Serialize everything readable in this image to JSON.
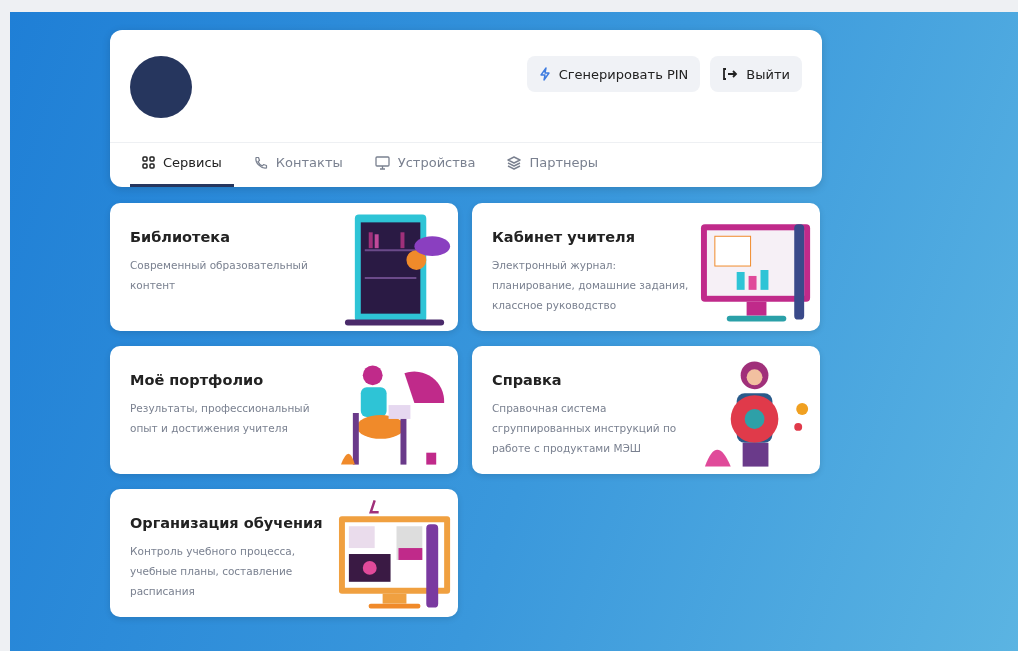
{
  "header": {
    "buttons": [
      {
        "kind": "pin",
        "label": "Сгенерировать PIN"
      },
      {
        "kind": "logout",
        "label": "Выйти"
      }
    ]
  },
  "tabs": [
    {
      "kind": "grid",
      "label": "Сервисы",
      "selected": true
    },
    {
      "kind": "phone",
      "label": "Контакты",
      "selected": false
    },
    {
      "kind": "monitor",
      "label": "Устройства",
      "selected": false
    },
    {
      "kind": "layers",
      "label": "Партнеры",
      "selected": false
    }
  ],
  "services": [
    {
      "kind": "library",
      "title": "Библиотека",
      "description": "Современный образовательный контент"
    },
    {
      "kind": "cabinet",
      "title": "Кабинет учителя",
      "description": "Электронный журнал: планирование, домашние задания, классное руководство"
    },
    {
      "kind": "portfolio",
      "title": "Моё портфолио",
      "description": "Результаты, профессиональный опыт и достижения учителя"
    },
    {
      "kind": "help",
      "title": "Справка",
      "description": "Справочная система сгруппированных инструкций по работе с продуктами МЭШ"
    },
    {
      "kind": "organization",
      "title": "Организация обучения",
      "description": "Контроль учебного процесса, учебные планы, составление расписания"
    }
  ]
}
